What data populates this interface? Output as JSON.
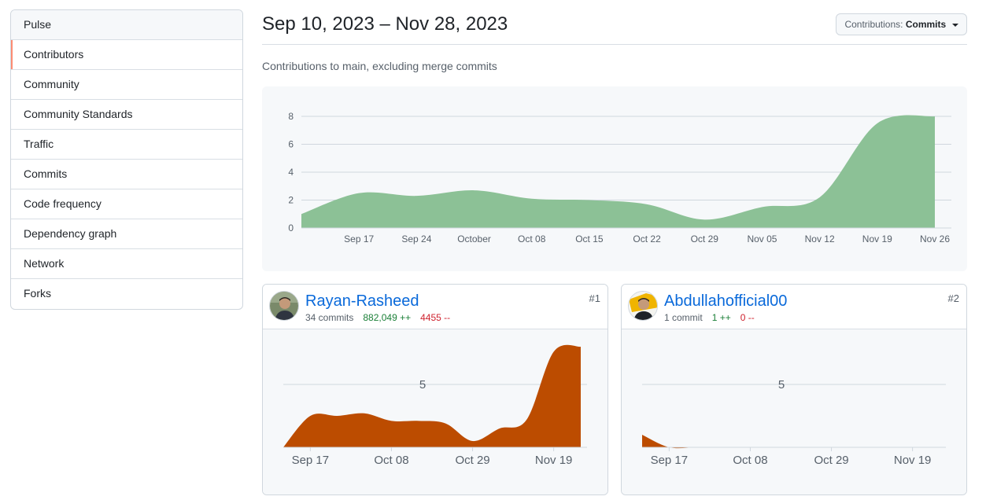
{
  "sidebar": {
    "items": [
      {
        "label": "Pulse"
      },
      {
        "label": "Contributors"
      },
      {
        "label": "Community"
      },
      {
        "label": "Community Standards"
      },
      {
        "label": "Traffic"
      },
      {
        "label": "Commits"
      },
      {
        "label": "Code frequency"
      },
      {
        "label": "Dependency graph"
      },
      {
        "label": "Network"
      },
      {
        "label": "Forks"
      }
    ],
    "selected": "Contributors"
  },
  "header": {
    "date_range": "Sep 10, 2023 – Nov 28, 2023",
    "contrib_prefix": "Contributions:",
    "contrib_value": "Commits"
  },
  "subtitle": "Contributions to main, excluding merge commits",
  "colors": {
    "main_fill": "#8cc196",
    "contributor_fill": "#bc4c00",
    "selected_accent": "#fd8c73",
    "link": "#0969da",
    "additions": "#1a7f37",
    "deletions": "#cf222e"
  },
  "chart_data": [
    {
      "type": "area",
      "title": "",
      "x": [
        "Sep 10",
        "Sep 17",
        "Sep 24",
        "Oct 01",
        "Oct 08",
        "Oct 15",
        "Oct 22",
        "Oct 29",
        "Nov 05",
        "Nov 12",
        "Nov 19",
        "Nov 26"
      ],
      "values": [
        1,
        2.5,
        2.3,
        2.7,
        2.1,
        2.0,
        1.7,
        0.6,
        1.5,
        2.2,
        7.5,
        8
      ],
      "xticks": [
        "Sep 17",
        "Sep 24",
        "October",
        "Oct 08",
        "Oct 15",
        "Oct 22",
        "Oct 29",
        "Nov 05",
        "Nov 12",
        "Nov 19",
        "Nov 26"
      ],
      "yticks": [
        "0",
        "2",
        "4",
        "6",
        "8"
      ],
      "ylim": [
        0,
        8
      ],
      "grid": true
    },
    {
      "type": "area",
      "series_label": "Rayan-Rasheed",
      "x": [
        "Sep 10",
        "Sep 17",
        "Sep 24",
        "Oct 01",
        "Oct 08",
        "Oct 15",
        "Oct 22",
        "Oct 29",
        "Nov 05",
        "Nov 12",
        "Nov 19",
        "Nov 26"
      ],
      "values": [
        0,
        2.5,
        2.5,
        2.7,
        2.1,
        2.1,
        1.9,
        0.5,
        1.5,
        2.2,
        7.6,
        8
      ],
      "xticks": [
        "Sep 17",
        "Oct 08",
        "Oct 29",
        "Nov 19"
      ],
      "yticks": [
        "5"
      ],
      "ylim": [
        0,
        8
      ]
    },
    {
      "type": "area",
      "series_label": "Abdullahofficial00",
      "x": [
        "Sep 10",
        "Sep 17",
        "Sep 24",
        "Oct 01",
        "Oct 08",
        "Oct 15",
        "Oct 22",
        "Oct 29",
        "Nov 05",
        "Nov 12",
        "Nov 19",
        "Nov 26"
      ],
      "values": [
        1,
        0,
        0,
        0,
        0,
        0,
        0,
        0,
        0,
        0,
        0,
        0
      ],
      "xticks": [
        "Sep 17",
        "Oct 08",
        "Oct 29",
        "Nov 19"
      ],
      "yticks": [
        "5"
      ],
      "ylim": [
        0,
        8
      ]
    }
  ],
  "contributors": [
    {
      "name": "Rayan-Rasheed",
      "commits": "34 commits",
      "additions": "882,049 ++",
      "deletions": "4455 --",
      "rank": "#1"
    },
    {
      "name": "Abdullahofficial00",
      "commits": "1 commit",
      "additions": "1 ++",
      "deletions": "0 --",
      "rank": "#2"
    }
  ]
}
